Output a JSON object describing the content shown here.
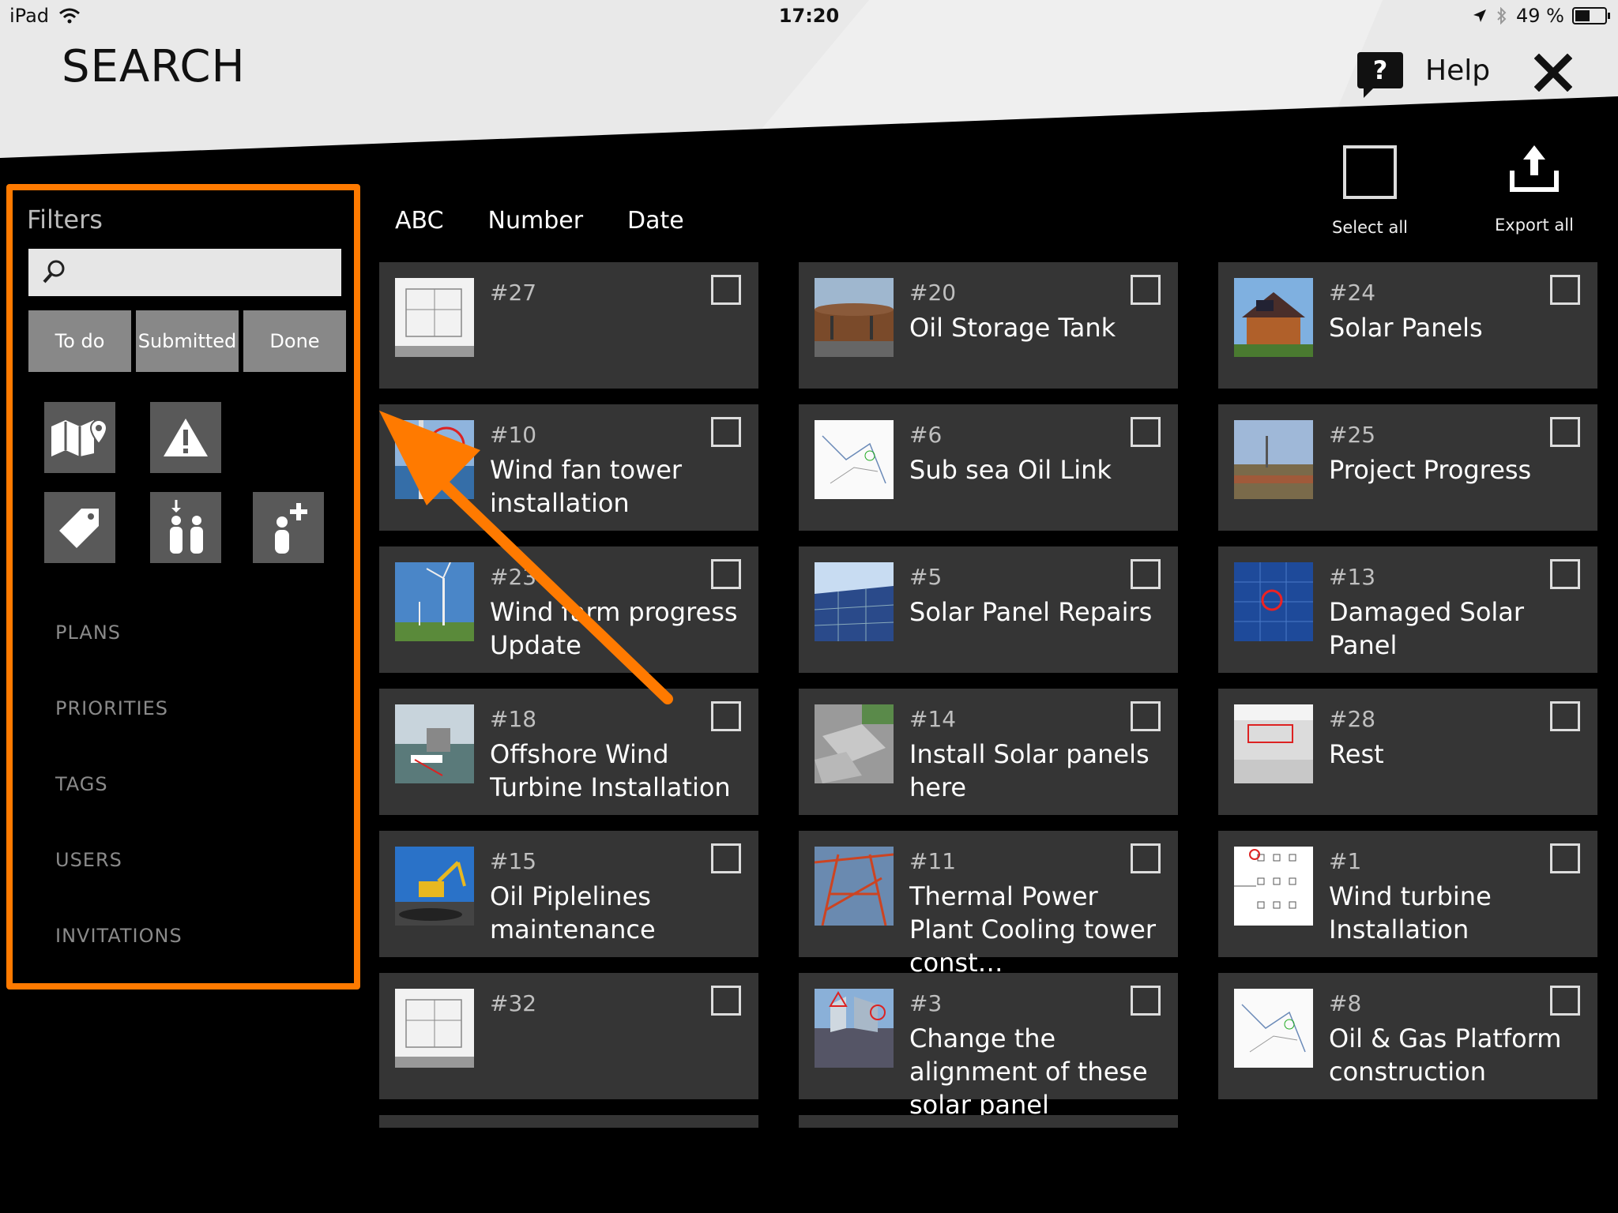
{
  "status_bar": {
    "device": "iPad",
    "time": "17:20",
    "battery": "49 %"
  },
  "header": {
    "title": "SEARCH",
    "help_label": "Help",
    "help_icon": "?"
  },
  "sort_tabs": [
    "ABC",
    "Number",
    "Date"
  ],
  "actions": {
    "select_all": "Select all",
    "export_all": "Export all"
  },
  "filters": {
    "title": "Filters",
    "search_placeholder": "",
    "status_buttons": [
      "To do",
      "Submitted",
      "Done"
    ],
    "categories": [
      "PLANS",
      "PRIORITIES",
      "TAGS",
      "USERS",
      "INVITATIONS"
    ]
  },
  "colors": {
    "highlight": "#ff7a00",
    "card": "#353535",
    "status_button": "#888888"
  },
  "cards": [
    {
      "number": "#27",
      "title": "",
      "thumb": "plan"
    },
    {
      "number": "#20",
      "title": "Oil Storage Tank",
      "thumb": "tank"
    },
    {
      "number": "#24",
      "title": "Solar Panels",
      "thumb": "house"
    },
    {
      "number": "#10",
      "title": "Wind fan tower installation",
      "thumb": "tower"
    },
    {
      "number": "#6",
      "title": "Sub sea Oil Link",
      "thumb": "map"
    },
    {
      "number": "#25",
      "title": "Project Progress",
      "thumb": "field"
    },
    {
      "number": "#23",
      "title": "Wind farm progress Update",
      "thumb": "windfarm"
    },
    {
      "number": "#5",
      "title": "Solar Panel Repairs",
      "thumb": "solar"
    },
    {
      "number": "#13",
      "title": "Damaged Solar Panel",
      "thumb": "damaged"
    },
    {
      "number": "#18",
      "title": "Offshore Wind Turbine Installation",
      "thumb": "offshore"
    },
    {
      "number": "#14",
      "title": "Install Solar panels here",
      "thumb": "panels"
    },
    {
      "number": "#28",
      "title": "Rest",
      "thumb": "room"
    },
    {
      "number": "#15",
      "title": "Oil Piplelines maintenance",
      "thumb": "excavator"
    },
    {
      "number": "#11",
      "title": "Thermal Power Plant Cooling tower const…",
      "thumb": "crane"
    },
    {
      "number": "#1",
      "title": "Wind turbine Installation",
      "thumb": "diagram"
    },
    {
      "number": "#32",
      "title": "",
      "thumb": "plan"
    },
    {
      "number": "#3",
      "title": "Change the alignment of these solar panel",
      "thumb": "alignment"
    },
    {
      "number": "#8",
      "title": "Oil & Gas Platform construction",
      "thumb": "map"
    }
  ]
}
